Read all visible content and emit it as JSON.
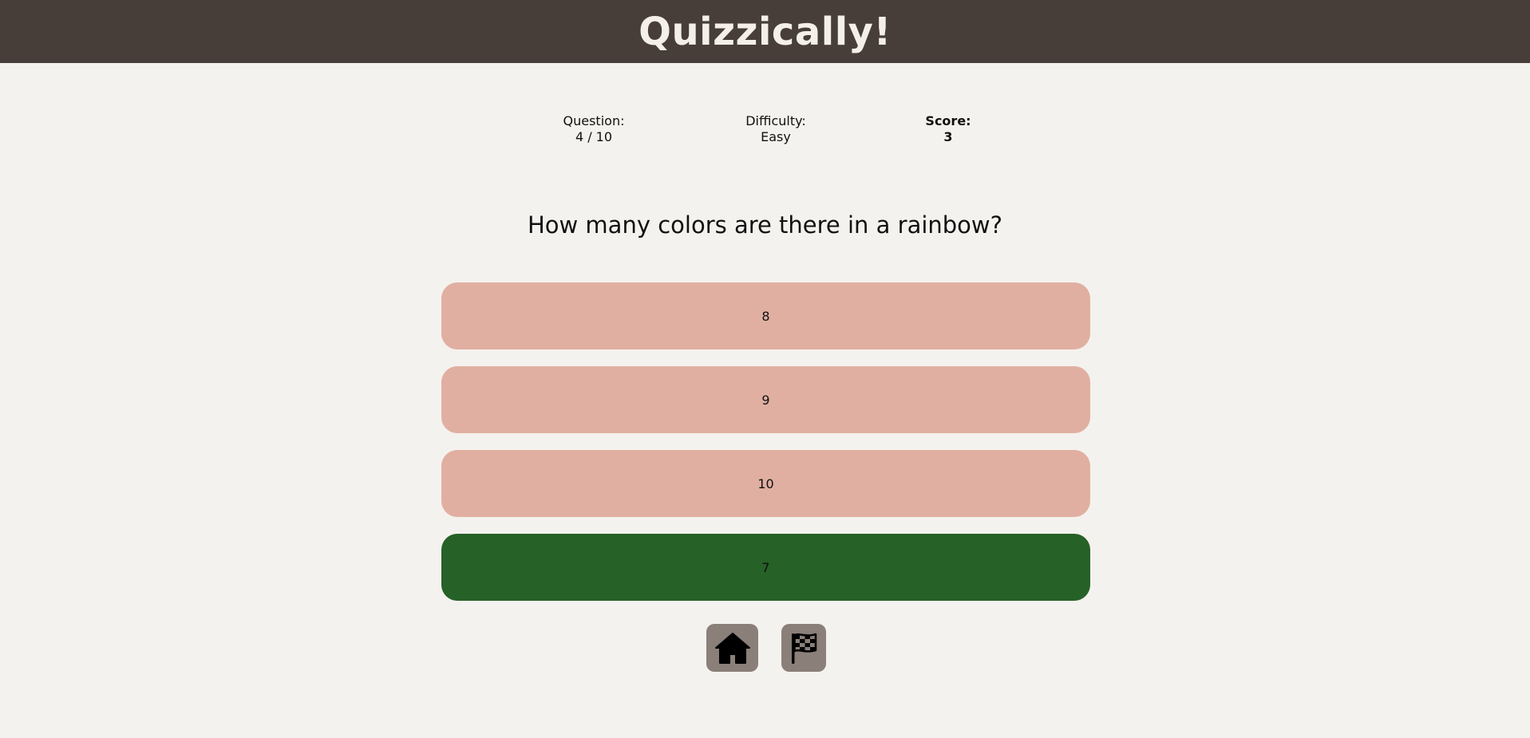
{
  "app": {
    "title": "Quizzically!"
  },
  "stats": {
    "question_label": "Question:",
    "question_value": "4 / 10",
    "difficulty_label": "Difficulty:",
    "difficulty_value": "Easy",
    "score_label": "Score:",
    "score_value": "3"
  },
  "question": {
    "text": "How many colors are there in a rainbow?"
  },
  "answers": [
    {
      "label": "8",
      "state": "incorrect"
    },
    {
      "label": "9",
      "state": "incorrect"
    },
    {
      "label": "10",
      "state": "incorrect"
    },
    {
      "label": "7",
      "state": "correct"
    }
  ],
  "controls": {
    "home_icon": "home-icon",
    "finish_icon": "checkered-flag-icon"
  },
  "colors": {
    "header_bg": "#473e39",
    "page_bg": "#f4f2ee",
    "answer_incorrect": "#e1afa2",
    "answer_correct": "#266127",
    "icon_button_bg": "#8a7f79"
  }
}
